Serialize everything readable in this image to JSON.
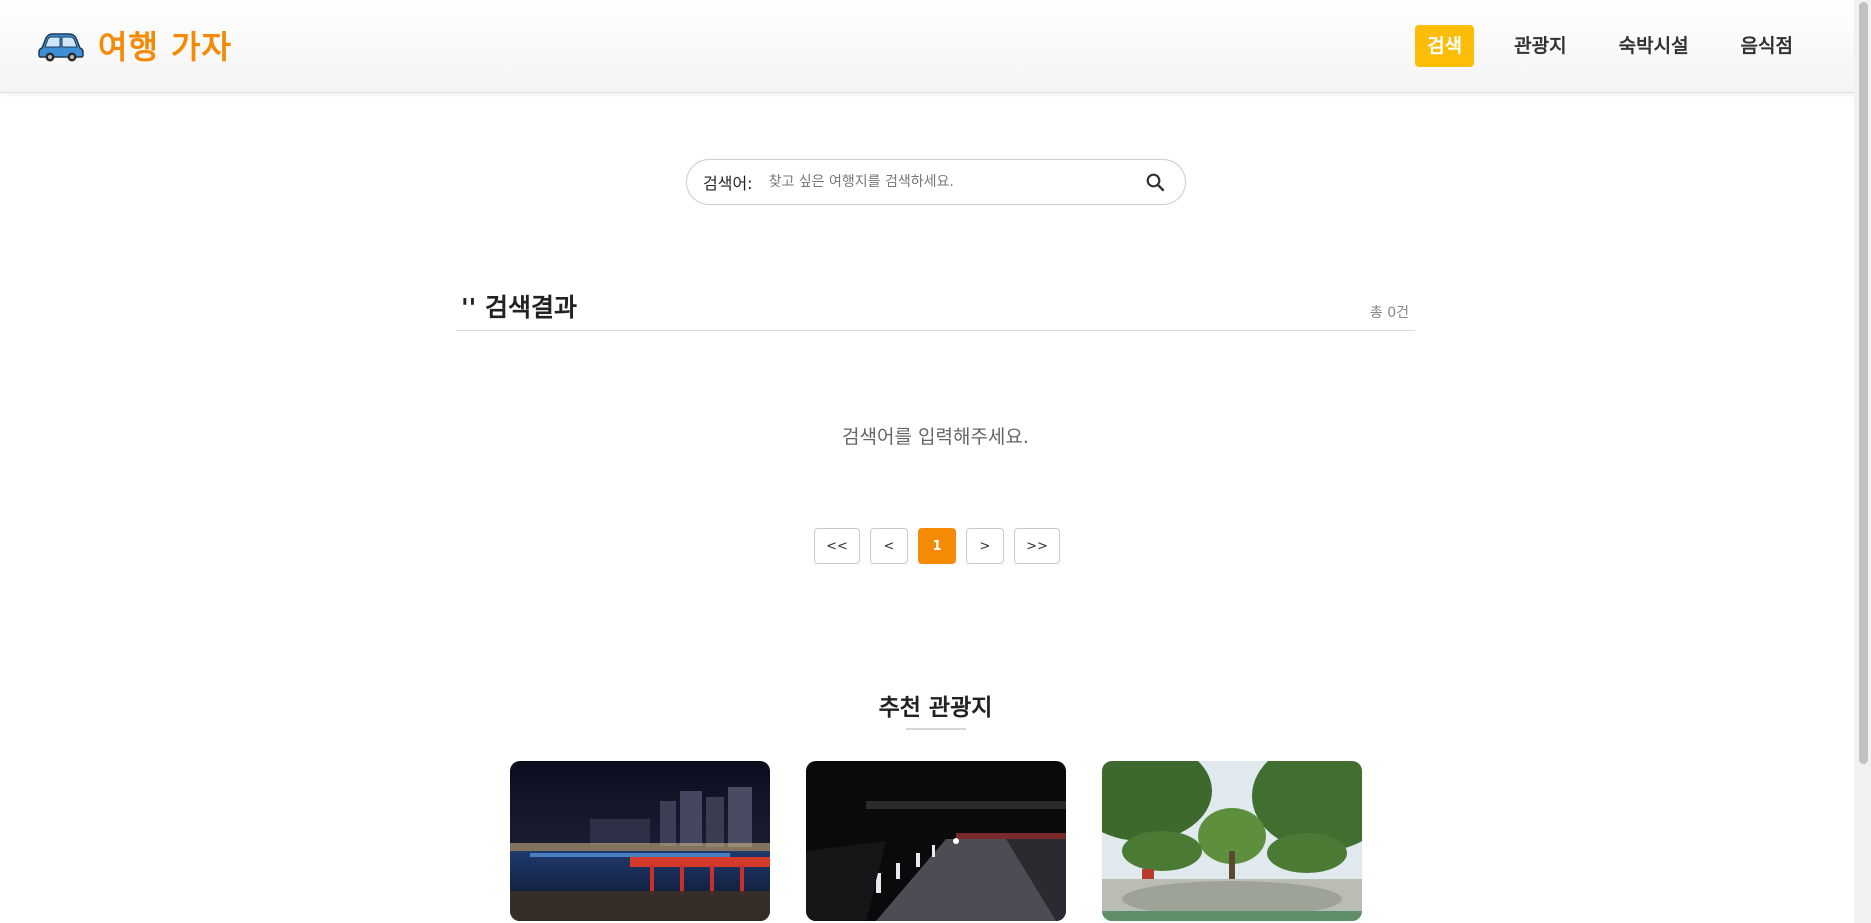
{
  "header": {
    "logo_icon": "car-icon",
    "logo_text": "여행 가자",
    "nav": [
      {
        "label": "검색",
        "active": true
      },
      {
        "label": "관광지",
        "active": false
      },
      {
        "label": "숙박시설",
        "active": false
      },
      {
        "label": "음식점",
        "active": false
      }
    ]
  },
  "search": {
    "label": "검색어:",
    "value": "",
    "placeholder": "찾고 싶은 여행지를 검색하세요.",
    "button_icon": "search-icon"
  },
  "results": {
    "title": "'' 검색결과",
    "count": "총 0건",
    "empty_message": "검색어를 입력해주세요."
  },
  "pagination": {
    "first": "<<",
    "prev": "<",
    "current": "1",
    "next": ">",
    "last": ">>"
  },
  "recommendations": {
    "title": "추천 관광지",
    "cards": [
      {
        "image": "night-waterfront-bridge-photo"
      },
      {
        "image": "night-lit-walkway-photo"
      },
      {
        "image": "park-plaza-trees-photo"
      }
    ]
  },
  "colors": {
    "brand": "#f58a07",
    "nav_active": "#fbbd08"
  }
}
